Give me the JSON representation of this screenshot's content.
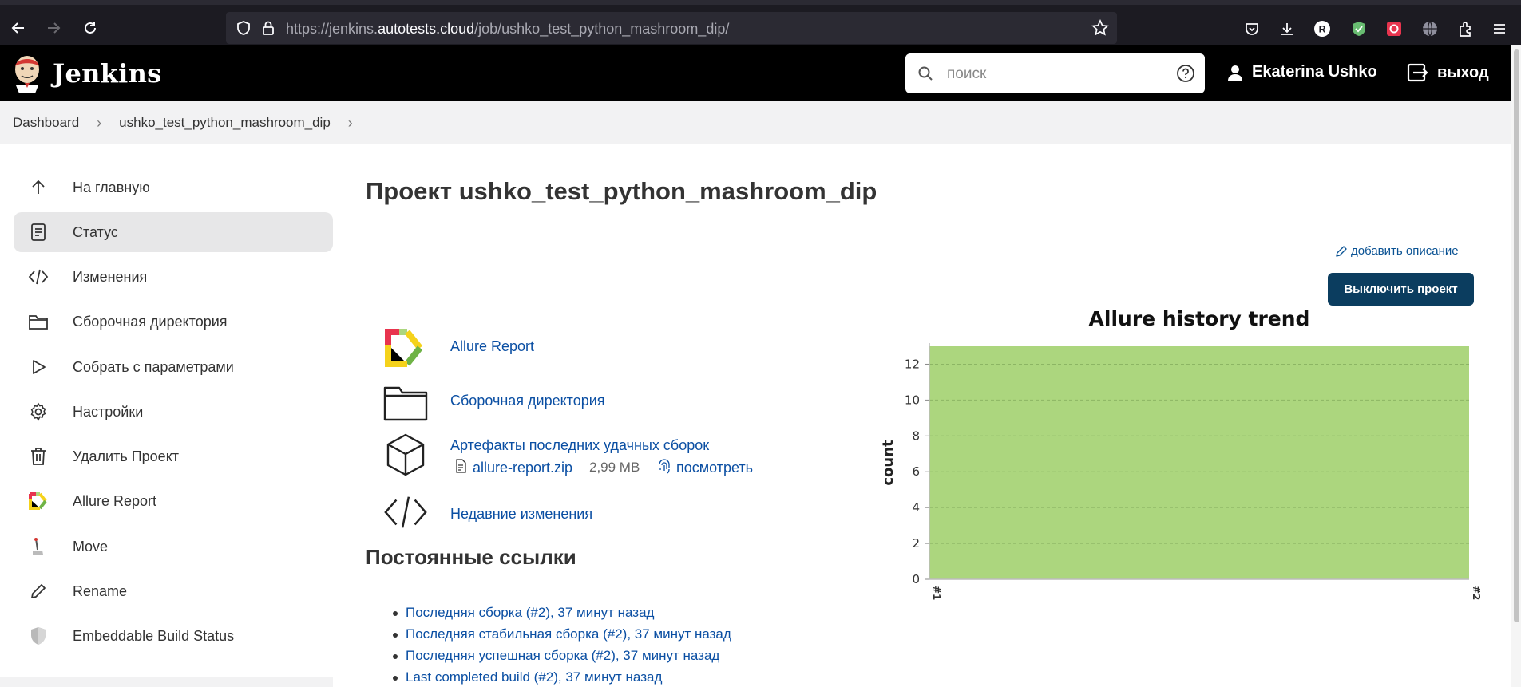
{
  "browser": {
    "url_prefix": "https://jenkins.",
    "url_host": "autotests.cloud",
    "url_path": "/job/ushko_test_python_mashroom_dip/"
  },
  "header": {
    "brand": "Jenkins",
    "search_placeholder": "поиск",
    "user_name": "Ekaterina Ushko",
    "logout_label": "выход"
  },
  "breadcrumb": {
    "items": [
      "Dashboard",
      "ushko_test_python_mashroom_dip"
    ]
  },
  "sidebar": {
    "items": [
      {
        "label": "На главную",
        "icon": "arrow-up-icon"
      },
      {
        "label": "Статус",
        "icon": "document-icon",
        "active": true
      },
      {
        "label": "Изменения",
        "icon": "code-icon"
      },
      {
        "label": "Сборочная директория",
        "icon": "folder-icon"
      },
      {
        "label": "Собрать с параметрами",
        "icon": "play-icon"
      },
      {
        "label": "Настройки",
        "icon": "gear-icon"
      },
      {
        "label": "Удалить Проект",
        "icon": "trash-icon"
      },
      {
        "label": "Allure Report",
        "icon": "allure-icon"
      },
      {
        "label": "Move",
        "icon": "move-icon"
      },
      {
        "label": "Rename",
        "icon": "pencil-icon"
      },
      {
        "label": "Embeddable Build Status",
        "icon": "shield-icon"
      }
    ]
  },
  "main": {
    "title": "Проект ushko_test_python_mashroom_dip",
    "add_description": "добавить описание",
    "disable_button": "Выключить проект",
    "links": {
      "allure_report": "Allure Report",
      "workspace": "Сборочная директория",
      "artifacts": "Артефакты последних удачных сборок",
      "artifact_file": "allure-report.zip",
      "artifact_size": "2,99 MB",
      "artifact_view": "посмотреть",
      "recent_changes": "Недавние изменения"
    },
    "permalinks_title": "Постоянные ссылки",
    "permalinks": [
      "Последняя сборка (#2), 37 минут назад",
      "Последняя стабильная сборка (#2), 37 минут назад",
      "Последняя успешная сборка (#2), 37 минут назад",
      "Last completed build (#2), 37 минут назад"
    ]
  },
  "chart_data": {
    "type": "area",
    "title": "Allure history trend",
    "xlabel": "",
    "ylabel": "count",
    "categories": [
      "#1",
      "#2"
    ],
    "series": [
      {
        "values": [
          13,
          13
        ],
        "color": "#acd67e"
      }
    ],
    "yticks": [
      0,
      2,
      4,
      6,
      8,
      10,
      12
    ],
    "ylim": [
      0,
      13
    ],
    "grid": true
  },
  "colors": {
    "link": "#0b4fa3",
    "header_bg": "#000000",
    "button_bg": "#0b3d5f",
    "chart_fill": "#acd67e"
  }
}
